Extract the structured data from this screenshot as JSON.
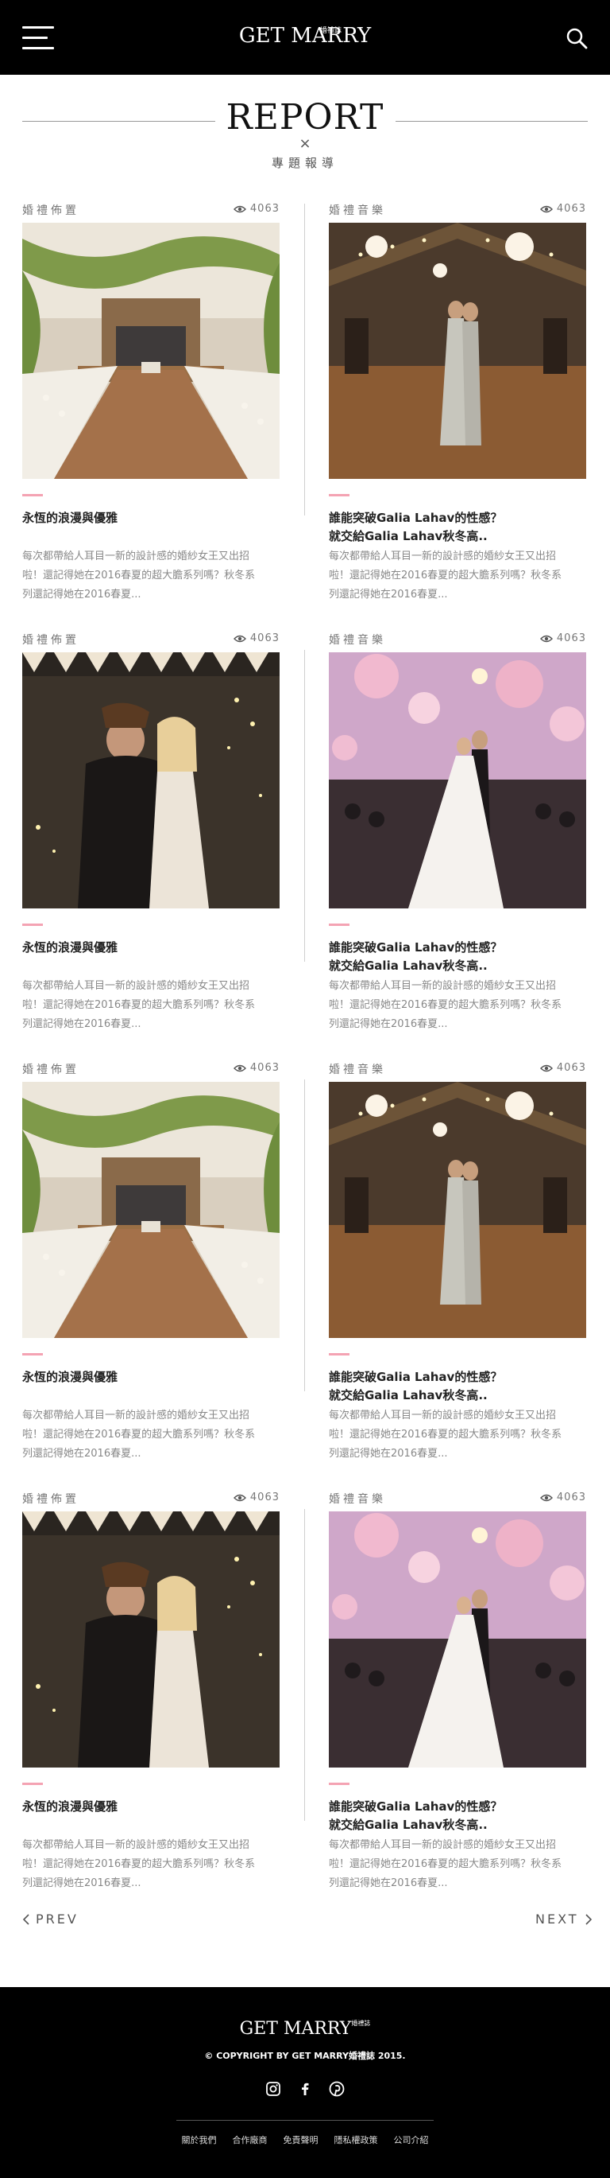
{
  "header": {
    "logo_main": "GET MARRY",
    "logo_sub": "婚禮誌"
  },
  "section": {
    "title_en": "REPORT",
    "cross": "×",
    "title_zh": "專題報導"
  },
  "cards": [
    {
      "category": "婚禮佈置",
      "views": "4063",
      "title_line1": "永恆的浪漫與優雅",
      "title_line2": "",
      "desc_line1": "每次都帶給人耳目一新的設計感的婚紗女王又出招",
      "desc_line2": "啦！還記得她在2016春夏的超大膽系列嗎？秋冬系",
      "desc_line3": "列還記得她在2016春夏...",
      "image": "barn-reception"
    },
    {
      "category": "婚禮音樂",
      "views": "4063",
      "title_line1": "誰能突破Galia Lahav的性感？",
      "title_line2": "就交給Galia Lahav秋冬高..",
      "desc_line1": "每次都帶給人耳目一新的設計感的婚紗女王又出招",
      "desc_line2": "啦！還記得她在2016春夏的超大膽系列嗎？秋冬系",
      "desc_line3": "列還記得她在2016春夏...",
      "image": "first-dance-barn"
    },
    {
      "category": "婚禮佈置",
      "views": "4063",
      "title_line1": "永恆的浪漫與優雅",
      "title_line2": "",
      "desc_line1": "每次都帶給人耳目一新的設計感的婚紗女王又出招",
      "desc_line2": "啦！還記得她在2016春夏的超大膽系列嗎？秋冬系",
      "desc_line3": "列還記得她在2016春夏...",
      "image": "sparkler-kiss"
    },
    {
      "category": "婚禮音樂",
      "views": "4063",
      "title_line1": "誰能突破Galia Lahav的性感？",
      "title_line2": "就交給Galia Lahav秋冬高..",
      "desc_line1": "每次都帶給人耳目一新的設計感的婚紗女王又出招",
      "desc_line2": "啦！還記得她在2016春夏的超大膽系列嗎？秋冬系",
      "desc_line3": "列還記得她在2016春夏...",
      "image": "lantern-dance"
    },
    {
      "category": "婚禮佈置",
      "views": "4063",
      "title_line1": "永恆的浪漫與優雅",
      "title_line2": "",
      "desc_line1": "每次都帶給人耳目一新的設計感的婚紗女王又出招",
      "desc_line2": "啦！還記得她在2016春夏的超大膽系列嗎？秋冬系",
      "desc_line3": "列還記得她在2016春夏...",
      "image": "barn-reception"
    },
    {
      "category": "婚禮音樂",
      "views": "4063",
      "title_line1": "誰能突破Galia Lahav的性感？",
      "title_line2": "就交給Galia Lahav秋冬高..",
      "desc_line1": "每次都帶給人耳目一新的設計感的婚紗女王又出招",
      "desc_line2": "啦！還記得她在2016春夏的超大膽系列嗎？秋冬系",
      "desc_line3": "列還記得她在2016春夏...",
      "image": "first-dance-barn"
    },
    {
      "category": "婚禮佈置",
      "views": "4063",
      "title_line1": "永恆的浪漫與優雅",
      "title_line2": "",
      "desc_line1": "每次都帶給人耳目一新的設計感的婚紗女王又出招",
      "desc_line2": "啦！還記得她在2016春夏的超大膽系列嗎？秋冬系",
      "desc_line3": "列還記得她在2016春夏...",
      "image": "sparkler-kiss"
    },
    {
      "category": "婚禮音樂",
      "views": "4063",
      "title_line1": "誰能突破Galia Lahav的性感？",
      "title_line2": "就交給Galia Lahav秋冬高..",
      "desc_line1": "每次都帶給人耳目一新的設計感的婚紗女王又出招",
      "desc_line2": "啦！還記得她在2016春夏的超大膽系列嗎？秋冬系",
      "desc_line3": "列還記得她在2016春夏...",
      "image": "lantern-dance"
    }
  ],
  "pager": {
    "prev": "PREV",
    "next": "NEXT"
  },
  "footer": {
    "logo_main": "GET MARRY",
    "logo_sub": "婚禮誌",
    "copyright": "© COPYRIGHT BY GET MARRY婚禮誌 2015.",
    "links": [
      "關於我們",
      "合作廠商",
      "免責聲明",
      "隱私權政策",
      "公司介紹"
    ]
  },
  "colors": {
    "accent_pink": "#f4a3b3",
    "header_bg": "#000000"
  }
}
